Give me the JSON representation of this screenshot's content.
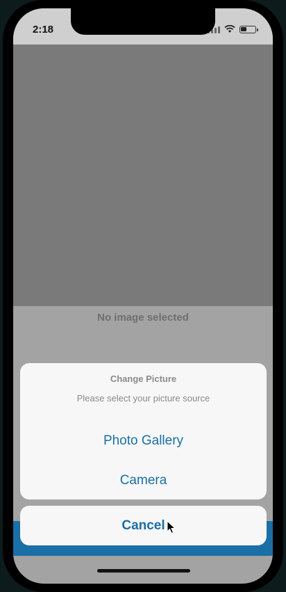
{
  "status_bar": {
    "time": "2:18"
  },
  "main": {
    "no_image_text": "No image selected"
  },
  "action_sheet": {
    "title": "Change Picture",
    "message": "Please select your picture source",
    "options": [
      "Photo Gallery",
      "Camera"
    ],
    "cancel_label": "Cancel"
  },
  "colors": {
    "accent": "#1a6fa6",
    "sheet_bg": "#f7f7f7",
    "overlay": "#a3a3a3"
  },
  "icons": [
    "signal-icon",
    "wifi-icon",
    "battery-icon",
    "cursor-icon"
  ]
}
